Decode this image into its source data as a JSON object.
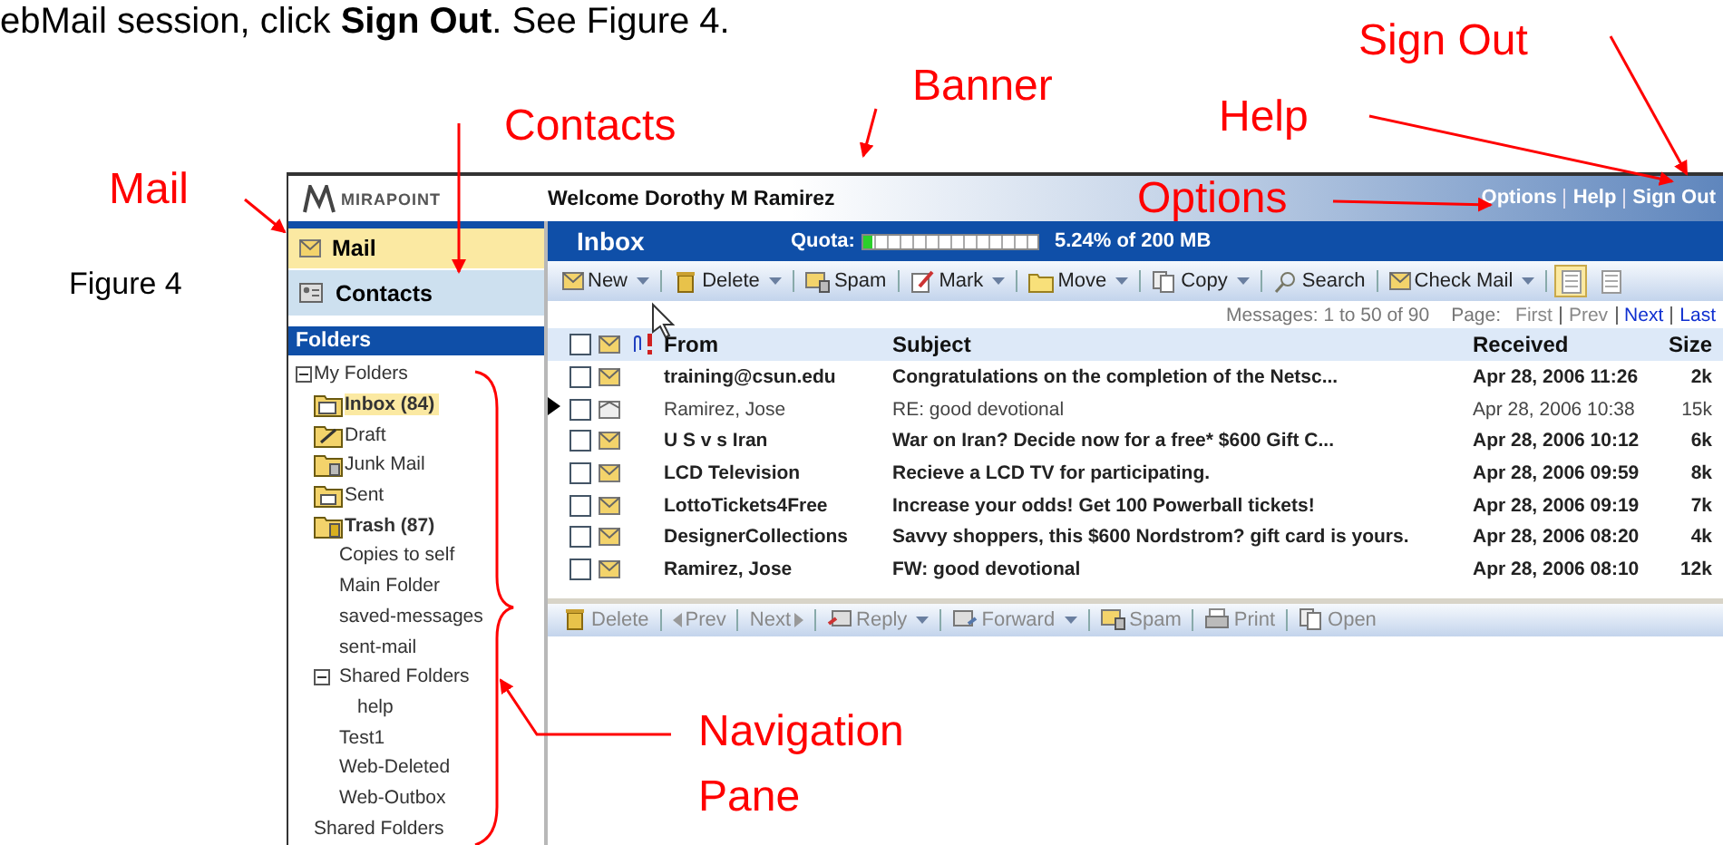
{
  "doc_text": "ebMail session, click **Sign Out**.  See Figure 4.",
  "figure_label": "Figure 4",
  "callouts": [
    {
      "text": "Mail"
    },
    {
      "text": "Contacts"
    },
    {
      "text": "Banner"
    },
    {
      "text": "Help"
    },
    {
      "text": "Sign Out"
    },
    {
      "text": "Options"
    },
    {
      "text": "Navigation Pane"
    }
  ],
  "banner": {
    "logo": "MIRAPOINT",
    "welcome": "Welcome Dorothy M Ramirez",
    "links": [
      "Options",
      "Help",
      "Sign Out"
    ]
  },
  "nav": [
    {
      "label": "Mail",
      "selected": true,
      "kind": "mail"
    },
    {
      "label": "Contacts",
      "selected": false,
      "kind": "contacts"
    }
  ],
  "folders_title": "Folders",
  "folders": [
    {
      "label": "My Folders",
      "expanded": true,
      "selected": false,
      "children": [
        {
          "label": "Inbox (84)",
          "kind": "inbox",
          "unread": true,
          "selected": true
        },
        {
          "label": "Draft",
          "kind": "draft",
          "unread": false,
          "selected": false
        },
        {
          "label": "Junk Mail",
          "kind": "junk",
          "unread": false,
          "selected": false
        },
        {
          "label": "Sent",
          "kind": "sent",
          "unread": false,
          "selected": false
        },
        {
          "label": "Trash (87)",
          "kind": "trash",
          "unread": true,
          "selected": false
        },
        {
          "label": "Copies to self",
          "selected": false
        },
        {
          "label": "Main Folder",
          "selected": false
        },
        {
          "label": "saved-messages",
          "selected": false
        },
        {
          "label": "sent-mail",
          "selected": false
        },
        {
          "label": "Shared Folders",
          "expanded": true,
          "selected": false,
          "children": [
            {
              "label": "help",
              "selected": false
            }
          ]
        },
        {
          "label": "Test1",
          "selected": false
        },
        {
          "label": "Web-Deleted",
          "selected": false
        },
        {
          "label": "Web-Outbox",
          "selected": false
        }
      ]
    },
    {
      "label": "Shared Folders",
      "selected": false
    }
  ],
  "inbox": {
    "title": "Inbox",
    "quota_label": "Quota:",
    "quota_meter": {
      "level": 0.0524
    },
    "quota_text": "5.24% of 200 MB"
  },
  "toolbar": [
    {
      "label": "New",
      "kind": "envelope",
      "dropdown": true
    },
    {
      "label": "Delete",
      "kind": "trash",
      "dropdown": true
    },
    {
      "label": "Spam",
      "kind": "junk",
      "dropdown": false
    },
    {
      "label": "Mark",
      "kind": "pencil",
      "dropdown": true
    },
    {
      "label": "Move",
      "kind": "folder",
      "dropdown": true
    },
    {
      "label": "Copy",
      "kind": "copy",
      "dropdown": true
    },
    {
      "label": "Search",
      "kind": "search",
      "dropdown": false
    },
    {
      "label": "Check Mail",
      "kind": "envelope",
      "dropdown": true
    }
  ],
  "view_buttons": [
    {
      "selected": true
    },
    {
      "selected": false
    }
  ],
  "messages_info": "Messages: 1 to 50 of 90",
  "page_label": "Page:",
  "page_links": [
    {
      "label": "First",
      "enabled": false
    },
    {
      "label": "Prev",
      "enabled": false
    },
    {
      "label": "Next",
      "enabled": true
    },
    {
      "label": "Last",
      "enabled": true
    }
  ],
  "select_all_checked": false,
  "columns": [
    "From",
    "Subject",
    "Received",
    "Size"
  ],
  "rows": [
    {
      "from": "training@csun.edu",
      "subject": "Congratulations on the completion of the Netsc...",
      "received": "Apr 28, 2006 11:26",
      "size": "2k",
      "checked": false,
      "read": false,
      "current": false
    },
    {
      "from": "Ramirez, Jose",
      "subject": "RE: good devotional",
      "received": "Apr 28, 2006 10:38",
      "size": "15k",
      "checked": false,
      "read": true,
      "current": true
    },
    {
      "from": "U S  v s  Iran",
      "subject": "War on Iran? Decide now for a free* $600 Gift C...",
      "received": "Apr 28, 2006 10:12",
      "size": "6k",
      "checked": false,
      "read": false,
      "current": false
    },
    {
      "from": "LCD Television",
      "subject": "Recieve a LCD TV for participating.",
      "received": "Apr 28, 2006 09:59",
      "size": "8k",
      "checked": false,
      "read": false,
      "current": false
    },
    {
      "from": "LottoTickets4Free",
      "subject": "Increase your odds! Get 100 Powerball tickets!",
      "received": "Apr 28, 2006 09:19",
      "size": "7k",
      "checked": false,
      "read": false,
      "current": false
    },
    {
      "from": "DesignerCollections",
      "subject": "Savvy shoppers, this $600 Nordstrom? gift card is yours.",
      "received": "Apr 28, 2006 08:20",
      "size": "4k",
      "checked": false,
      "read": false,
      "current": false
    },
    {
      "from": "Ramirez, Jose",
      "subject": "FW: good devotional",
      "received": "Apr 28, 2006 08:10",
      "size": "12k",
      "checked": false,
      "read": false,
      "current": false
    }
  ],
  "preview_toolbar": [
    {
      "label": "Delete",
      "kind": "trash",
      "dropdown": false
    },
    {
      "label": "Prev",
      "kind": "prev",
      "dropdown": false
    },
    {
      "label": "Next",
      "kind": "next",
      "dropdown": false
    },
    {
      "label": "Reply",
      "kind": "reply",
      "dropdown": true
    },
    {
      "label": "Forward",
      "kind": "forward",
      "dropdown": true
    },
    {
      "label": "Spam",
      "kind": "junk",
      "dropdown": false
    },
    {
      "label": "Print",
      "kind": "printer",
      "dropdown": false
    },
    {
      "label": "Open",
      "kind": "copy",
      "dropdown": false
    }
  ]
}
